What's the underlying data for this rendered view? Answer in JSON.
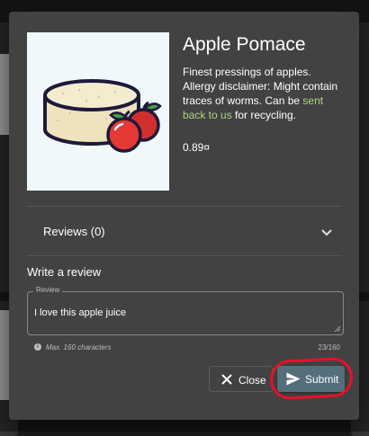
{
  "product": {
    "name": "Apple Pomace",
    "description_prefix": "Finest pressings of apples. Allergy disclaimer: Might contain traces of worms. Can be ",
    "description_link": "sent back to us",
    "description_suffix": " for recycling.",
    "price": "0.89¤",
    "image_icon": "apple-pomace-icon"
  },
  "reviews": {
    "title": "Reviews (0)",
    "expand_icon": "chevron-down-icon"
  },
  "write_review": {
    "title": "Write a review",
    "field_label": "Review",
    "value": "I love this apple juice",
    "hint": "Max. 160 characters",
    "char_count": "23/160"
  },
  "actions": {
    "close_label": "Close",
    "submit_label": "Submit"
  },
  "colors": {
    "dialog_bg": "#424242",
    "link": "#aed581",
    "submit_bg": "#546e7a",
    "annotation": "#e8102a"
  }
}
